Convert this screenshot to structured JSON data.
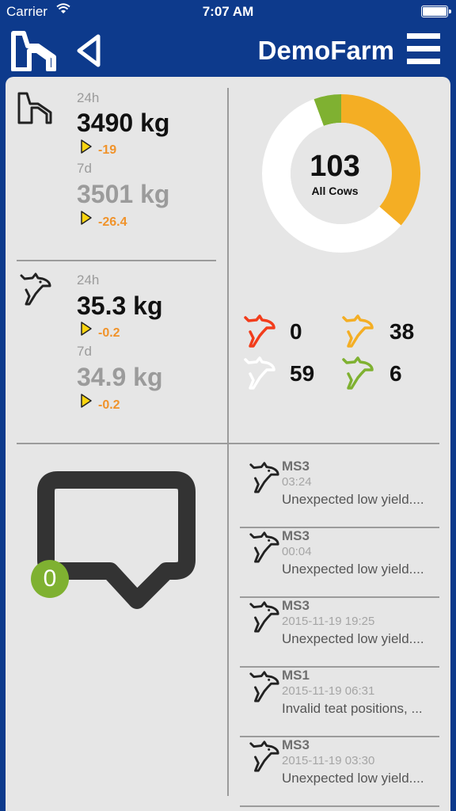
{
  "status_bar": {
    "carrier": "Carrier",
    "time": "7:07 AM"
  },
  "nav": {
    "title": "DemoFarm"
  },
  "colors": {
    "bar": "#0d3a8c",
    "panel": "#e6e6e6",
    "accent_orange": "#f0932b",
    "donut_orange": "#f4ae24",
    "donut_green": "#7fb131",
    "cow_red": "#f23c1b",
    "cow_yellow": "#f4ae24",
    "cow_green": "#7fb131"
  },
  "farm_metric": {
    "label_24h": "24h",
    "value_24h": "3490 kg",
    "delta_24h": "-19",
    "label_7d": "7d",
    "value_7d": "3501 kg",
    "delta_7d": "-26.4"
  },
  "cow_metric": {
    "label_24h": "24h",
    "value_24h": "35.3 kg",
    "delta_24h": "-0.2",
    "label_7d": "7d",
    "value_7d": "34.9 kg",
    "delta_7d": "-0.2"
  },
  "donut": {
    "total": "103",
    "label": "All Cows"
  },
  "cow_counts": {
    "red": "0",
    "yellow": "38",
    "white": "59",
    "green": "6"
  },
  "messages": {
    "count": "0"
  },
  "alerts": [
    {
      "name": "MS3",
      "time": "03:24",
      "message": "Unexpected low yield...."
    },
    {
      "name": "MS3",
      "time": "00:04",
      "message": "Unexpected low yield...."
    },
    {
      "name": "MS3",
      "time": "2015-11-19 19:25",
      "message": "Unexpected low yield...."
    },
    {
      "name": "MS1",
      "time": "2015-11-19 06:31",
      "message": "Invalid teat positions, ..."
    },
    {
      "name": "MS3",
      "time": "2015-11-19 03:30",
      "message": "Unexpected low yield...."
    }
  ]
}
